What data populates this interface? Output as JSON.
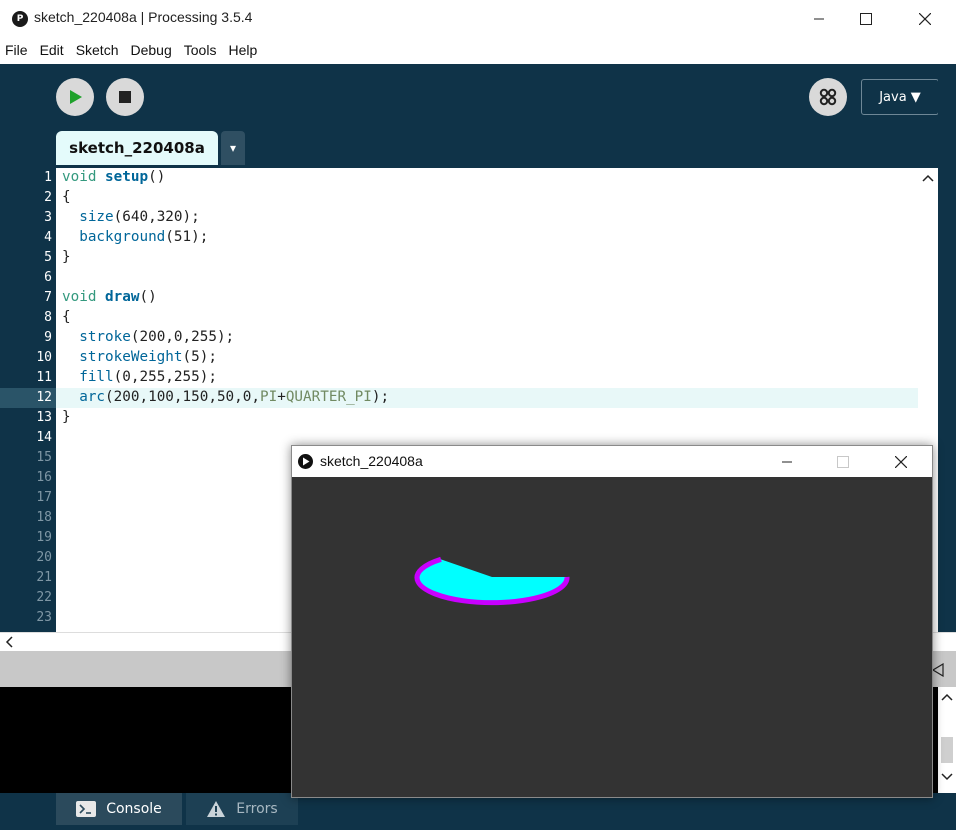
{
  "window": {
    "title": "sketch_220408a | Processing 3.5.4",
    "app_icon_glyph": "P"
  },
  "menu": [
    "File",
    "Edit",
    "Sketch",
    "Debug",
    "Tools",
    "Help"
  ],
  "toolbar": {
    "mode": "Java ▼"
  },
  "tab": {
    "name": "sketch_220408a",
    "menu_glyph": "▾"
  },
  "editor": {
    "line_numbers": [
      "1",
      "2",
      "3",
      "4",
      "5",
      "6",
      "7",
      "8",
      "9",
      "10",
      "11",
      "12",
      "13",
      "14",
      "15",
      "16",
      "17",
      "18",
      "19",
      "20",
      "21",
      "22",
      "23"
    ],
    "current_line": 12
  },
  "bottom_tabs": {
    "console": "Console",
    "errors": "Errors"
  },
  "sketch_window": {
    "title": "sketch_220408a",
    "background": "#333333",
    "stroke": "#c800ff",
    "fill": "#00ffff"
  },
  "colors": {
    "toolbar_bg": "#0f3348",
    "tab_bg": "#e4fbfb",
    "run_green": "#1fa12b"
  },
  "icons": [
    "run-icon",
    "stop-icon",
    "debugger-icon",
    "console-icon",
    "warning-icon",
    "minimize-icon",
    "maximize-icon",
    "close-icon"
  ]
}
